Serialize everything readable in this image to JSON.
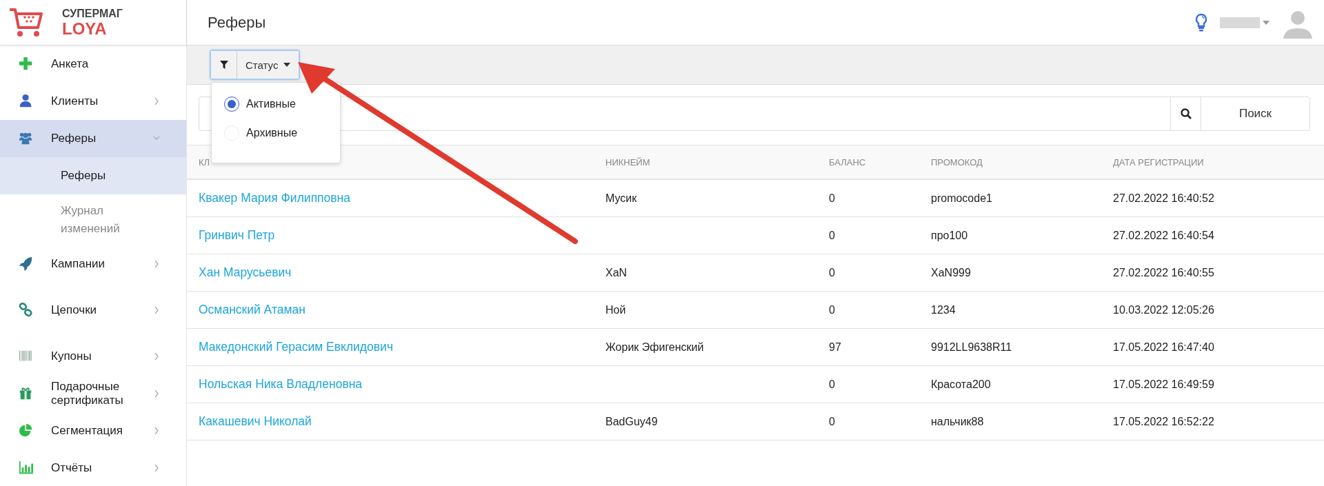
{
  "brand": {
    "line1": "СУПЕРМАГ",
    "line2": "LOYA"
  },
  "header": {
    "title": "Реферы"
  },
  "sidebar": {
    "items": [
      {
        "label": "Анкета",
        "selected": false,
        "expandable": false,
        "expanded": false
      },
      {
        "label": "Клиенты",
        "selected": false,
        "expandable": true,
        "expanded": false
      },
      {
        "label": "Реферы",
        "selected": true,
        "expandable": true,
        "expanded": true,
        "children": [
          {
            "label": "Реферы",
            "selected": true
          },
          {
            "label": "Журнал изменений",
            "selected": false
          }
        ]
      },
      {
        "label": "Кампании",
        "selected": false,
        "expandable": true,
        "expanded": false
      },
      {
        "label": "Цепочки",
        "selected": false,
        "expandable": true,
        "expanded": false
      },
      {
        "label": "Купоны",
        "selected": false,
        "expandable": true,
        "expanded": false
      },
      {
        "label": "Подарочные сертификаты",
        "selected": false,
        "expandable": true,
        "expanded": false
      },
      {
        "label": "Сегментация",
        "selected": false,
        "expandable": true,
        "expanded": false
      },
      {
        "label": "Отчёты",
        "selected": false,
        "expandable": true,
        "expanded": false
      }
    ]
  },
  "filter": {
    "label": "Статус",
    "expanded": true,
    "options": [
      {
        "label": "Активные",
        "selected": true
      },
      {
        "label": "Архивные",
        "selected": false
      }
    ]
  },
  "search": {
    "button": "Поиск"
  },
  "table": {
    "columns": [
      "КЛ",
      "НИКНЕЙМ",
      "БАЛАНС",
      "ПРОМОКОД",
      "ДАТА РЕГИСТРАЦИИ"
    ],
    "rows": [
      [
        "Квакер Мария Филипповна",
        "Мусик",
        "0",
        "promocode1",
        "27.02.2022 16:40:52"
      ],
      [
        "Гринвич Петр",
        "",
        "0",
        "про100",
        "27.02.2022 16:40:54"
      ],
      [
        "Хан Марусьевич",
        "XaN",
        "0",
        "XaN999",
        "27.02.2022 16:40:55"
      ],
      [
        "Османский Атаман",
        "Ной",
        "0",
        "1234",
        "10.03.2022 12:05:26"
      ],
      [
        "Македонский Герасим Евклидович",
        "Жорик Эфигенский",
        "97",
        "9912LL9638R11",
        "17.05.2022 16:47:40"
      ],
      [
        "Нольская Ника Владленовна",
        "",
        "0",
        "Красота200",
        "17.05.2022 16:49:59"
      ],
      [
        "Какашевич Николай",
        "BadGuy49",
        "0",
        "нальчик88",
        "17.05.2022 16:52:22"
      ]
    ]
  }
}
